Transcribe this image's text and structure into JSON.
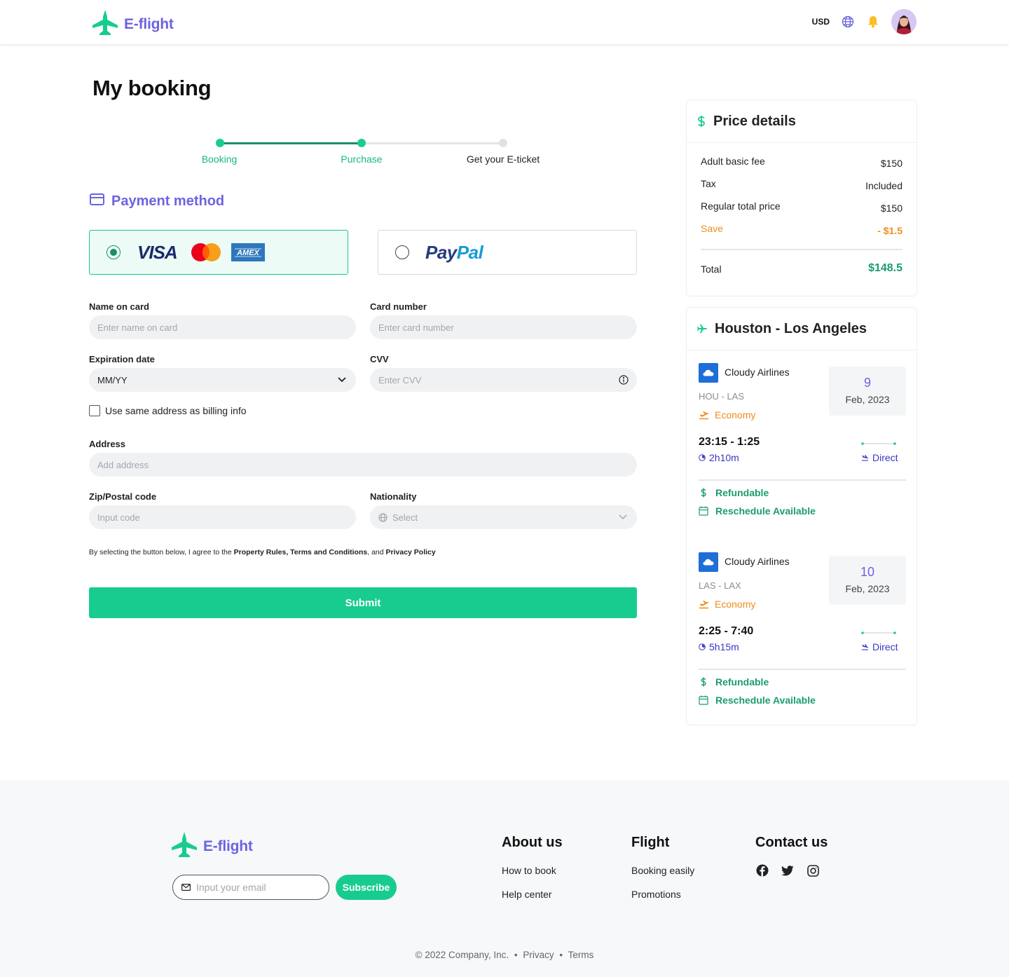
{
  "header": {
    "brand": "E-flight",
    "currency": "USD"
  },
  "page": {
    "title": "My booking"
  },
  "stepper": {
    "steps": [
      {
        "label": "Booking",
        "state": "done"
      },
      {
        "label": "Purchase",
        "state": "current"
      },
      {
        "label": "Get your E-ticket",
        "state": "upcoming"
      }
    ]
  },
  "payment": {
    "title": "Payment method",
    "options": [
      {
        "id": "card",
        "brands": [
          "VISA",
          "Mastercard",
          "AMEX"
        ],
        "selected": true
      },
      {
        "id": "paypal",
        "brand_a": "Pay",
        "brand_b": "Pal",
        "selected": false
      }
    ]
  },
  "form": {
    "name_on_card": {
      "label": "Name on card",
      "placeholder": "Enter name on card"
    },
    "card_number": {
      "label": "Card number",
      "placeholder": "Enter card number"
    },
    "expiration": {
      "label": "Expiration date",
      "value": "MM/YY"
    },
    "cvv": {
      "label": "CVV",
      "placeholder": "Enter CVV"
    },
    "same_address": {
      "label": "Use same address as billing info",
      "checked": false
    },
    "address": {
      "label": "Address",
      "placeholder": "Add address"
    },
    "zip": {
      "label": "Zip/Postal code",
      "placeholder": "Input code"
    },
    "nationality": {
      "label": "Nationality",
      "placeholder": "Select"
    },
    "terms": {
      "prefix": "By selecting the button below, I agree to the ",
      "link1": "Property Rules, Terms and Conditions",
      "middle": ", and ",
      "link2": "Privacy Policy"
    },
    "submit_label": "Submit"
  },
  "price_details": {
    "title": "Price details",
    "rows": [
      {
        "label": "Adult basic fee",
        "value": "$150"
      },
      {
        "label": "Tax",
        "value": "Included"
      },
      {
        "label": "Regular total price",
        "value": "$150"
      },
      {
        "label": "Save",
        "value": "- $1.5"
      }
    ],
    "total_label": "Total",
    "total_value": "$148.5"
  },
  "itinerary": {
    "title": "Houston - Los Angeles",
    "segments": [
      {
        "airline": "Cloudy Airlines",
        "route": "HOU - LAS",
        "cabin": "Economy",
        "day": "9",
        "month_year": "Feb, 2023",
        "times": "23:15 - 1:25",
        "duration": "2h10m",
        "stops": "Direct",
        "perk1": "Refundable",
        "perk2": "Reschedule Available"
      },
      {
        "airline": "Cloudy Airlines",
        "route": "LAS - LAX",
        "cabin": "Economy",
        "day": "10",
        "month_year": "Feb, 2023",
        "times": "2:25 - 7:40",
        "duration": "5h15m",
        "stops": "Direct",
        "perk1": "Refundable",
        "perk2": "Reschedule Available"
      }
    ]
  },
  "footer": {
    "brand": "E-flight",
    "email_placeholder": "Input your email",
    "subscribe_label": "Subscribe",
    "about": {
      "title": "About us",
      "links": [
        "How to book",
        "Help center"
      ]
    },
    "flight": {
      "title": "Flight",
      "links": [
        "Booking easily",
        "Promotions"
      ]
    },
    "contact": {
      "title": "Contact us",
      "socials": [
        "facebook-icon",
        "twitter-icon",
        "instagram-icon"
      ]
    },
    "copyright": "© 2022 Company, Inc.",
    "privacy": "Privacy",
    "terms": "Terms",
    "separator": "•"
  },
  "colors": {
    "brand_purple": "#6c63e0",
    "accent_green": "#18cc8f",
    "perk_green": "#1a9d6b",
    "economy_orange": "#f08c1a",
    "duration_blue": "#3a36c4"
  }
}
